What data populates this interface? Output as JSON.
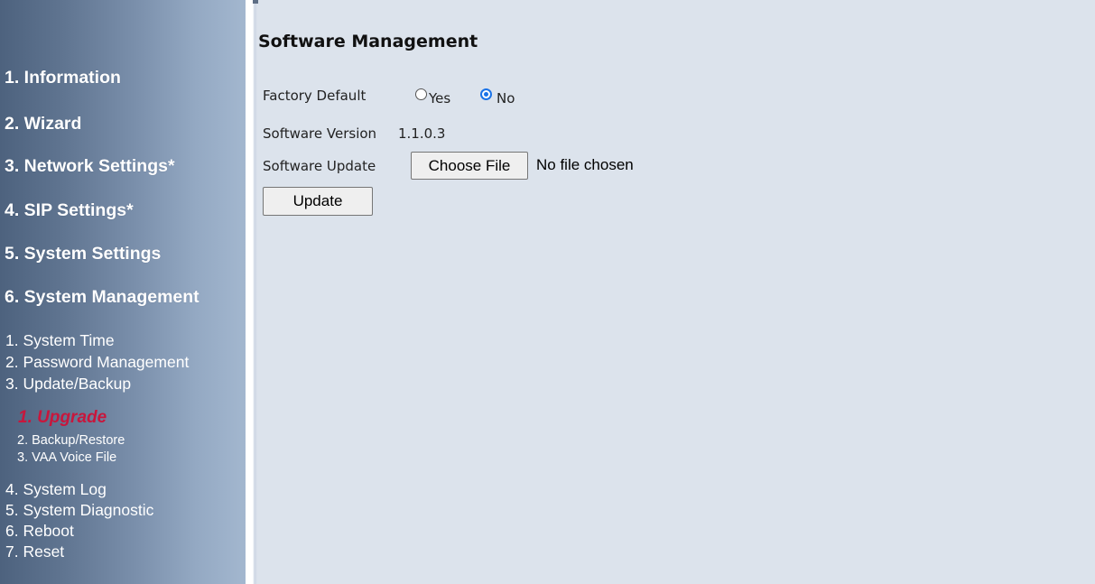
{
  "sidebar": {
    "menu": [
      {
        "label": "1. Information"
      },
      {
        "label": "2. Wizard"
      },
      {
        "label": "3. Network Settings*"
      },
      {
        "label": "4. SIP Settings*"
      },
      {
        "label": "5. System Settings"
      },
      {
        "label": "6. System Management"
      }
    ],
    "submenu": [
      {
        "label": "1. System Time"
      },
      {
        "label": "2. Password Management"
      },
      {
        "label": "3. Update/Backup"
      }
    ],
    "update_backup_items": [
      {
        "label": "1. Upgrade",
        "active": true
      },
      {
        "label": "2. Backup/Restore"
      },
      {
        "label": "3. VAA Voice File"
      }
    ],
    "submenu_more": [
      {
        "label": "4. System Log"
      },
      {
        "label": "5. System Diagnostic"
      },
      {
        "label": "6. Reboot"
      },
      {
        "label": "7. Reset"
      }
    ]
  },
  "main": {
    "title": "Software Management",
    "factory_default": {
      "label": "Factory Default",
      "options": [
        "Yes",
        "No"
      ],
      "selected": "No"
    },
    "software_version": {
      "label": "Software Version",
      "value": "1.1.0.3"
    },
    "software_update": {
      "label": "Software Update",
      "choose_file_label": "Choose File",
      "no_file_text": "No file chosen"
    },
    "update_button_label": "Update"
  },
  "colors": {
    "active_menu": "#c8163c",
    "content_bg": "#dce3ec",
    "radio_selected": "#1a73e8"
  }
}
